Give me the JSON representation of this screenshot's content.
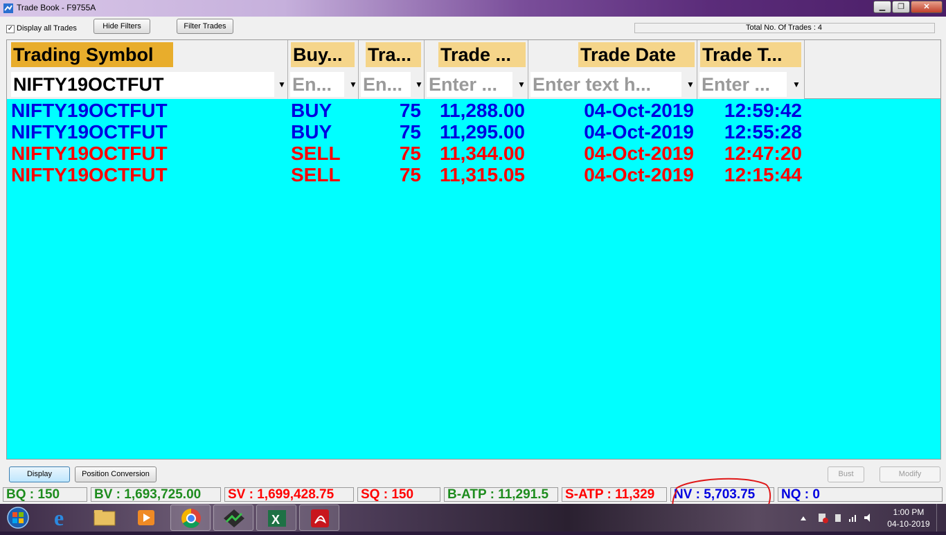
{
  "window": {
    "title": "Trade Book - F9755A",
    "minimize": "▁",
    "maximize": "❐",
    "close": "✕"
  },
  "toolbar": {
    "display_all_label": "Display all Trades",
    "display_all_checked": "✓",
    "hide_filters": "Hide Filters",
    "filter_trades": "Filter Trades",
    "total_trades": "Total No. Of Trades : 4"
  },
  "grid": {
    "columns": [
      "Trading Symbol",
      "Buy...",
      "Tra...",
      "Trade ...",
      "Trade Date",
      "Trade T..."
    ],
    "filters": [
      "NIFTY19OCTFUT",
      "En...",
      "En...",
      "Enter ...",
      "Enter text h...",
      "Enter ..."
    ],
    "filter_icon": "filter-funnel-icon",
    "rows": [
      {
        "symbol": "NIFTY19OCTFUT",
        "side": "BUY",
        "qty": "75",
        "price": "11,288.00",
        "date": "04-Oct-2019",
        "time": "12:59:42",
        "color": "#0000e0"
      },
      {
        "symbol": "NIFTY19OCTFUT",
        "side": "BUY",
        "qty": "75",
        "price": "11,295.00",
        "date": "04-Oct-2019",
        "time": "12:55:28",
        "color": "#0000e0"
      },
      {
        "symbol": "NIFTY19OCTFUT",
        "side": "SELL",
        "qty": "75",
        "price": "11,344.00",
        "date": "04-Oct-2019",
        "time": "12:47:20",
        "color": "#ff0000"
      },
      {
        "symbol": "NIFTY19OCTFUT",
        "side": "SELL",
        "qty": "75",
        "price": "11,315.05",
        "date": "04-Oct-2019",
        "time": "12:15:44",
        "color": "#ff0000"
      }
    ],
    "background": "#00ffff"
  },
  "actions": {
    "display": "Display",
    "position_conversion": "Position Conversion",
    "bust": "Bust",
    "modify": "Modify"
  },
  "status": {
    "bq": "BQ : 150",
    "bv": "BV : 1,693,725.00",
    "sv": "SV : 1,699,428.75",
    "sq": "SQ : 150",
    "batp": "B-ATP : 11,291.5",
    "satp": "S-ATP : 11,329",
    "nv": "NV : 5,703.75",
    "nq": "NQ : 0"
  },
  "taskbar": {
    "apps": [
      "start-orb-icon",
      "internet-explorer-icon",
      "file-explorer-icon",
      "media-player-icon",
      "chrome-icon",
      "trading-terminal-icon",
      "excel-icon",
      "acrobat-icon"
    ],
    "time": "1:00 PM",
    "date": "04-10-2019"
  },
  "colors": {
    "buy": "#0000e0",
    "sell": "#ff0000",
    "header_label_bg": "#f5d58a",
    "bq_color": "#1e8c1e"
  }
}
